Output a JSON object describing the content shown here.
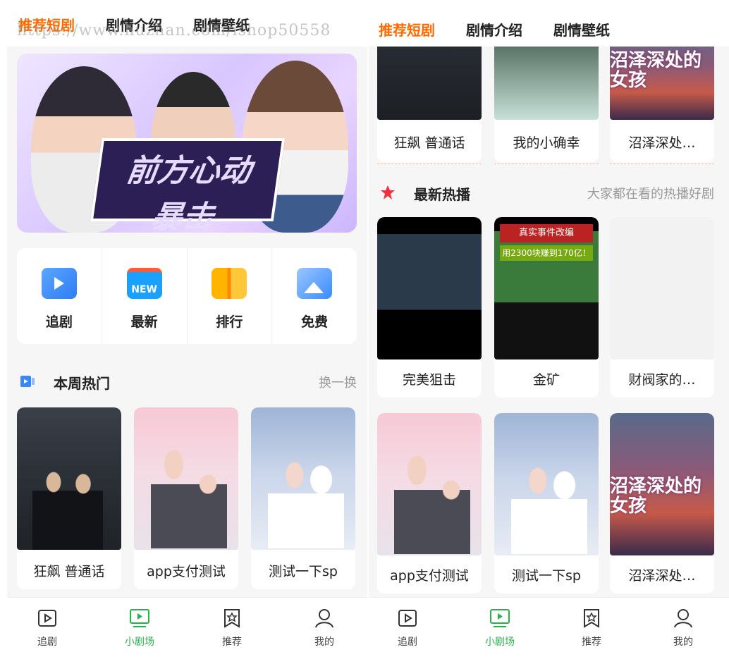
{
  "tabs": [
    "推荐短剧",
    "剧情介绍",
    "剧情壁纸"
  ],
  "watermark": "https://www.huzhan.com/ishop50558",
  "banner": {
    "slogan_line1": "前方心动",
    "slogan_line2": "暴击"
  },
  "shortcuts": [
    {
      "label": "追剧",
      "icon": "play-square-icon"
    },
    {
      "label": "最新",
      "icon": "new-calendar-icon",
      "badge": "NEW"
    },
    {
      "label": "排行",
      "icon": "ranking-icon"
    },
    {
      "label": "免费",
      "icon": "photo-icon"
    }
  ],
  "weekly_hot": {
    "title": "本周热门",
    "action": "换一换",
    "items": [
      "狂飙 普通话",
      "app支付测试",
      "测试一下sp"
    ]
  },
  "right_top_row": [
    "狂飙 普通话",
    "我的小确幸",
    "沼泽深处…"
  ],
  "latest_hot": {
    "title": "最新热播",
    "action": "大家都在看的热播好剧",
    "row1": [
      "完美狙击",
      "金矿",
      "财阀家的…"
    ],
    "row2": [
      "app支付测试",
      "测试一下sp",
      "沼泽深处…"
    ]
  },
  "poster_texts": {
    "swamp_title": "沼泽深处的女孩",
    "gold_pill1": "真实事件改编",
    "gold_pill2": "用2300块赚到170亿！"
  },
  "bottom_nav": [
    {
      "label": "追剧",
      "icon": "play-box-icon"
    },
    {
      "label": "小剧场",
      "icon": "tv-play-icon",
      "active": true
    },
    {
      "label": "推荐",
      "icon": "star-bookmark-icon"
    },
    {
      "label": "我的",
      "icon": "user-icon"
    }
  ],
  "colors": {
    "accent_orange": "#ff6a00",
    "active_green": "#27b34a",
    "background": "#f6f6f6"
  }
}
